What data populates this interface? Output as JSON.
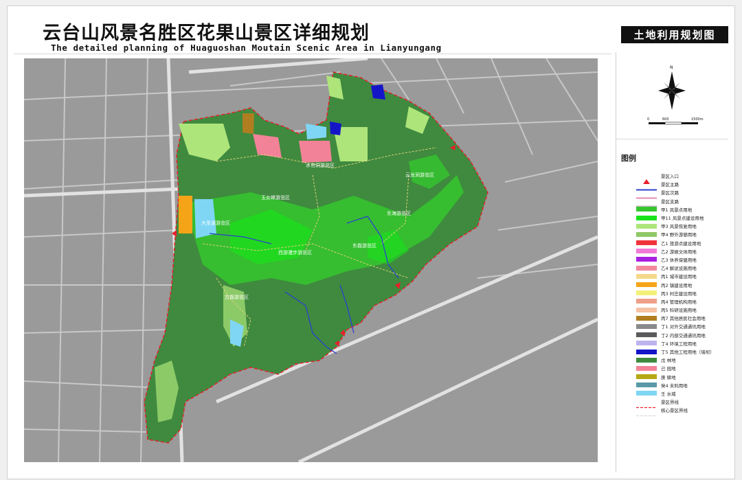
{
  "header": {
    "title_cn": "云台山风景名胜区花果山景区详细规划",
    "title_en": "The detailed planning of Huaguoshan Moutain Scenic Area in Lianyungang",
    "map_title": "土地利用规划图"
  },
  "scale_bar": {
    "labels": [
      "0",
      "600",
      "1500m"
    ],
    "north_label": "N"
  },
  "legend": {
    "title": "图例",
    "items": [
      {
        "label": "景区入口",
        "kind": "entrance",
        "color": "#e8202a"
      },
      {
        "label": "景区主路",
        "kind": "line",
        "color": "#2b3fd1"
      },
      {
        "label": "景区次路",
        "kind": "line",
        "color": "#e58ab5"
      },
      {
        "label": "景区支路",
        "kind": "line",
        "color": "#bfbfbf"
      },
      {
        "label": "甲1 风景点用地",
        "kind": "fill",
        "color": "#35c62e"
      },
      {
        "label": "甲11 风景点建设用地",
        "kind": "fill",
        "color": "#19e31a"
      },
      {
        "label": "甲3 风景恢复用地",
        "kind": "fill",
        "color": "#aee57a"
      },
      {
        "label": "甲4 野外游憩用地",
        "kind": "fill",
        "color": "#8fc866"
      },
      {
        "label": "乙1 旅游点建设用地",
        "kind": "fill",
        "color": "#f0333a"
      },
      {
        "label": "乙2 游娱文体用地",
        "kind": "fill",
        "color": "#f27ad7"
      },
      {
        "label": "乙3 休养保健用地",
        "kind": "fill",
        "color": "#a820e0"
      },
      {
        "label": "乙4 解说设施用地",
        "kind": "fill",
        "color": "#f2899c"
      },
      {
        "label": "丙1 城市建设用地",
        "kind": "fill",
        "color": "#f5d98a"
      },
      {
        "label": "丙2 镇建设用地",
        "kind": "fill",
        "color": "#f5a418"
      },
      {
        "label": "丙3 村庄建设用地",
        "kind": "fill",
        "color": "#f3f07a"
      },
      {
        "label": "丙4 管理机构用地",
        "kind": "fill",
        "color": "#f0a08a"
      },
      {
        "label": "丙5 科研设施用地",
        "kind": "fill",
        "color": "#f6c2a5"
      },
      {
        "label": "丙7 其他居民社会用地",
        "kind": "fill",
        "color": "#b07e20"
      },
      {
        "label": "丁1 对外交通通讯用地",
        "kind": "fill",
        "color": "#8a8a8a"
      },
      {
        "label": "丁2 内部交通通讯用地",
        "kind": "fill",
        "color": "#5a5a5a"
      },
      {
        "label": "丁4 环境工程用地",
        "kind": "fill",
        "color": "#bdb4ee"
      },
      {
        "label": "丁5 其他工程用地（墙坝）",
        "kind": "fill",
        "color": "#1515c8"
      },
      {
        "label": "戊 林地",
        "kind": "fill",
        "color": "#3f8a3f"
      },
      {
        "label": "己 园地",
        "kind": "fill",
        "color": "#f28297"
      },
      {
        "label": "庚 耕地",
        "kind": "fill",
        "color": "#b5a814"
      },
      {
        "label": "癸4 未利用地",
        "kind": "fill",
        "color": "#5a9aa6"
      },
      {
        "label": "壬 水域",
        "kind": "fill",
        "color": "#7fd6f4"
      },
      {
        "label": "景区界线",
        "kind": "dash",
        "color": "#e8202a"
      },
      {
        "label": "核心景区界线",
        "kind": "dash",
        "color": "#d8d8d8"
      }
    ]
  },
  "map": {
    "zones": [
      {
        "label": "水帘洞游览区"
      },
      {
        "label": "云龙涧游览区"
      },
      {
        "label": "玉女峰游览区"
      },
      {
        "label": "东海游览区"
      },
      {
        "label": "大圣湖游览区"
      },
      {
        "label": "东磊游览区"
      },
      {
        "label": "西游漫步游览区"
      },
      {
        "label": "古磊游览区"
      }
    ],
    "colors": {
      "forest": "#3f8a3f",
      "forest_dark": "#2f7a36",
      "scenic": "#35c62e",
      "scenic_build": "#19e31a",
      "restore": "#aee57a",
      "water": "#7fd6f4",
      "road_main": "#2b3fd1",
      "boundary": "#e8202a",
      "town": "#f5a418"
    }
  }
}
